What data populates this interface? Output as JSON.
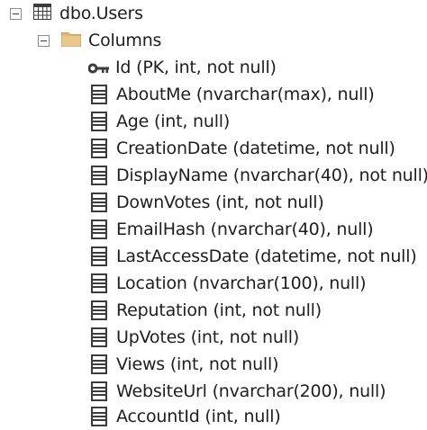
{
  "tree": {
    "table": {
      "label": "dbo.Users",
      "icon": "table-icon",
      "expanded": true
    },
    "folder": {
      "label": "Columns",
      "icon": "folder-icon",
      "expanded": true
    },
    "columns": [
      {
        "label": "Id (PK, int, not null)",
        "icon": "key-icon"
      },
      {
        "label": "AboutMe (nvarchar(max), null)",
        "icon": "column-icon"
      },
      {
        "label": "Age (int, null)",
        "icon": "column-icon"
      },
      {
        "label": "CreationDate (datetime, not null)",
        "icon": "column-icon"
      },
      {
        "label": "DisplayName (nvarchar(40), not null)",
        "icon": "column-icon"
      },
      {
        "label": "DownVotes (int, not null)",
        "icon": "column-icon"
      },
      {
        "label": "EmailHash (nvarchar(40), null)",
        "icon": "column-icon"
      },
      {
        "label": "LastAccessDate (datetime, not null)",
        "icon": "column-icon"
      },
      {
        "label": "Location (nvarchar(100), null)",
        "icon": "column-icon"
      },
      {
        "label": "Reputation (int, not null)",
        "icon": "column-icon"
      },
      {
        "label": "UpVotes (int, not null)",
        "icon": "column-icon"
      },
      {
        "label": "Views (int, not null)",
        "icon": "column-icon"
      },
      {
        "label": "WebsiteUrl (nvarchar(200), null)",
        "icon": "column-icon"
      },
      {
        "label": "AccountId (int, null)",
        "icon": "column-icon"
      }
    ]
  },
  "colors": {
    "text": "#1e1e1e",
    "icon": "#3c3c3c",
    "folder": "#dcb67a",
    "toggle_border": "#8c8c8c"
  }
}
